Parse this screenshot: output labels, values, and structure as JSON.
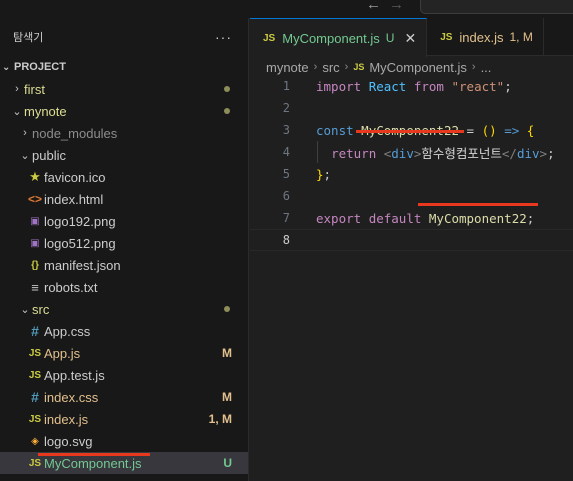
{
  "sidebar": {
    "title": "탐색기",
    "more": "···",
    "section": "PROJECT",
    "items": [
      {
        "label": "first",
        "kind": "folder",
        "status": "dot"
      },
      {
        "label": "mynote",
        "kind": "folder",
        "status": "dot"
      },
      {
        "label": "node_modules",
        "kind": "folder"
      },
      {
        "label": "public",
        "kind": "folder"
      },
      {
        "label": "favicon.ico",
        "icon": "star-icon"
      },
      {
        "label": "index.html",
        "icon": "html-icon"
      },
      {
        "label": "logo192.png",
        "icon": "image-icon"
      },
      {
        "label": "logo512.png",
        "icon": "image-icon"
      },
      {
        "label": "manifest.json",
        "icon": "json-icon"
      },
      {
        "label": "robots.txt",
        "icon": "text-lines-icon"
      },
      {
        "label": "src",
        "kind": "folder",
        "status": "dot"
      },
      {
        "label": "App.css",
        "icon": "css-hash-icon"
      },
      {
        "label": "App.js",
        "icon": "js-icon",
        "status": "M"
      },
      {
        "label": "App.test.js",
        "icon": "js-icon"
      },
      {
        "label": "index.css",
        "icon": "css-hash-icon",
        "status": "M"
      },
      {
        "label": "index.js",
        "icon": "js-icon",
        "status": "1, M"
      },
      {
        "label": "logo.svg",
        "icon": "svg-icon"
      },
      {
        "label": "MyComponent.js",
        "icon": "js-icon",
        "status": "U"
      }
    ]
  },
  "tabs": [
    {
      "label": "MyComponent.js",
      "badge": "U",
      "icon_text": "JS",
      "active": true
    },
    {
      "label": "index.js",
      "badge": "1, M",
      "icon_text": "JS",
      "active": false
    }
  ],
  "breadcrumb": [
    "mynote",
    "src",
    "MyComponent.js",
    "..."
  ],
  "editor": {
    "line_numbers": [
      "1",
      "2",
      "3",
      "4",
      "5",
      "6",
      "7",
      "8"
    ],
    "lines": [
      "import React from \"react\";",
      "",
      "const MyComponent22 = () => {",
      "  return <div>함수형컴포넌트</div>;",
      "};",
      "",
      "export default MyComponent22;",
      ""
    ]
  },
  "colors": {
    "accent": "#0078d4",
    "annotation": "#e8381e",
    "untracked": "#73c991",
    "modified": "#e2c08d"
  }
}
